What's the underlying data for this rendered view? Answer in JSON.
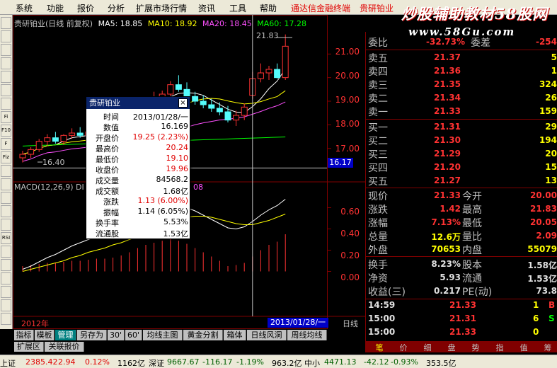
{
  "menu": {
    "items": [
      "系统",
      "功能",
      "报价",
      "分析",
      "扩展市场行情",
      "资讯",
      "工具",
      "帮助"
    ],
    "promo": "通达信金融终端",
    "current_stock": "贵研铂业",
    "watermark_line1": "炒股辅助教材58股网",
    "watermark_line2": "www.58Gu.com"
  },
  "toolbar_left": {
    "buttons": [
      "",
      "",
      "",
      "",
      "",
      "",
      "",
      "Fi",
      "F10",
      "F",
      "Fiz",
      "",
      "",
      "",
      "",
      "",
      "RSI",
      "",
      "",
      "",
      "",
      "",
      ""
    ]
  },
  "chart_header": {
    "stock": "贵研铂业(日线 前复权)",
    "ma5": "MA5: 18.85",
    "ma10": "MA10: 18.92",
    "ma20": "MA20: 18.45",
    "ma60": "MA60: 17.28"
  },
  "price_axis": [
    "21.00",
    "20.00",
    "19.00",
    "18.00",
    "17.00"
  ],
  "price_marker": "16.17",
  "high_annotation": "21.83",
  "low_annotation": "16.40",
  "macd_title": "MACD(12,26,9) DI",
  "macd_title_tail": "08",
  "macd_axis": [
    "0.60",
    "0.40",
    "0.20",
    "0.00"
  ],
  "date_left": "2012年",
  "date_cursor": "2013/01/28/一",
  "period": "日线",
  "chart_data": {
    "type": "candlestick",
    "series": [
      {
        "name": "MA5"
      },
      {
        "name": "MA10"
      },
      {
        "name": "MA20"
      },
      {
        "name": "MA60"
      }
    ],
    "candles": [
      {
        "o": 16.6,
        "h": 16.9,
        "l": 16.4,
        "c": 16.75
      },
      {
        "o": 16.75,
        "h": 17.05,
        "l": 16.6,
        "c": 16.95
      },
      {
        "o": 16.95,
        "h": 17.4,
        "l": 16.85,
        "c": 17.3
      },
      {
        "o": 17.3,
        "h": 17.6,
        "l": 17.1,
        "c": 17.45
      },
      {
        "o": 17.45,
        "h": 17.7,
        "l": 17.2,
        "c": 17.3
      },
      {
        "o": 17.3,
        "h": 17.6,
        "l": 17.15,
        "c": 17.55
      },
      {
        "o": 17.55,
        "h": 17.85,
        "l": 17.4,
        "c": 17.65
      },
      {
        "o": 17.65,
        "h": 17.9,
        "l": 17.45,
        "c": 17.55
      },
      {
        "o": 17.55,
        "h": 17.8,
        "l": 17.35,
        "c": 17.7
      },
      {
        "o": 17.7,
        "h": 18.0,
        "l": 17.55,
        "c": 17.85
      },
      {
        "o": 17.85,
        "h": 18.1,
        "l": 17.6,
        "c": 17.7
      },
      {
        "o": 17.7,
        "h": 17.95,
        "l": 17.5,
        "c": 17.8
      },
      {
        "o": 17.8,
        "h": 18.2,
        "l": 17.7,
        "c": 18.1
      },
      {
        "o": 18.1,
        "h": 18.6,
        "l": 17.95,
        "c": 18.45
      },
      {
        "o": 18.45,
        "h": 18.9,
        "l": 18.3,
        "c": 18.8
      },
      {
        "o": 18.8,
        "h": 19.2,
        "l": 18.6,
        "c": 19.05
      },
      {
        "o": 19.05,
        "h": 19.4,
        "l": 18.8,
        "c": 19.1
      },
      {
        "o": 19.1,
        "h": 19.45,
        "l": 18.85,
        "c": 19.3
      },
      {
        "o": 19.3,
        "h": 19.85,
        "l": 19.1,
        "c": 19.7
      },
      {
        "o": 19.7,
        "h": 20.1,
        "l": 19.4,
        "c": 19.5
      },
      {
        "o": 19.5,
        "h": 19.8,
        "l": 19.1,
        "c": 19.2
      },
      {
        "o": 19.2,
        "h": 19.4,
        "l": 18.85,
        "c": 19.0
      },
      {
        "o": 19.0,
        "h": 19.25,
        "l": 18.7,
        "c": 18.85
      },
      {
        "o": 18.85,
        "h": 19.1,
        "l": 18.55,
        "c": 18.7
      },
      {
        "o": 18.7,
        "h": 18.95,
        "l": 18.4,
        "c": 18.55
      },
      {
        "o": 18.55,
        "h": 18.8,
        "l": 18.1,
        "c": 18.2
      },
      {
        "o": 18.2,
        "h": 18.6,
        "l": 17.95,
        "c": 18.4
      },
      {
        "o": 18.4,
        "h": 18.9,
        "l": 18.2,
        "c": 18.75
      },
      {
        "o": 19.25,
        "h": 20.24,
        "l": 19.1,
        "c": 19.96
      },
      {
        "o": 19.96,
        "h": 20.6,
        "l": 19.8,
        "c": 20.2
      },
      {
        "o": 20.2,
        "h": 20.5,
        "l": 19.9,
        "c": 20.35
      },
      {
        "o": 20.35,
        "h": 20.6,
        "l": 19.95,
        "c": 20.0
      },
      {
        "o": 20.0,
        "h": 21.83,
        "l": 19.9,
        "c": 21.33
      }
    ],
    "macd": [
      0.05,
      0.06,
      0.07,
      0.08,
      0.08,
      0.09,
      0.1,
      0.1,
      0.11,
      0.12,
      0.12,
      0.13,
      0.15,
      0.18,
      0.22,
      0.25,
      0.27,
      0.29,
      0.31,
      0.29,
      0.26,
      0.22,
      0.18,
      0.14,
      0.1,
      0.05,
      0.06,
      0.08,
      0.14,
      0.2,
      0.25,
      0.28,
      0.35
    ],
    "diff": [
      0.02,
      0.05,
      0.09,
      0.13,
      0.16,
      0.2,
      0.24,
      0.27,
      0.3,
      0.33,
      0.35,
      0.37,
      0.4,
      0.44,
      0.5,
      0.55,
      0.58,
      0.6,
      0.62,
      0.62,
      0.6,
      0.57,
      0.53,
      0.49,
      0.45,
      0.41,
      0.4,
      0.42,
      0.47,
      0.53,
      0.58,
      0.62,
      0.68
    ],
    "dea": [
      0.0,
      0.02,
      0.04,
      0.06,
      0.08,
      0.1,
      0.13,
      0.15,
      0.18,
      0.2,
      0.22,
      0.25,
      0.27,
      0.3,
      0.33,
      0.36,
      0.4,
      0.43,
      0.46,
      0.49,
      0.51,
      0.52,
      0.52,
      0.51,
      0.49,
      0.47,
      0.45,
      0.44,
      0.44,
      0.46,
      0.48,
      0.51,
      0.54
    ],
    "cursor_index": 28,
    "ylim": [
      16.0,
      22.0
    ],
    "macd_ylim": [
      -0.05,
      0.75
    ]
  },
  "tooltip": {
    "title": "贵研铂业",
    "close": "×",
    "rows": [
      {
        "k": "时间",
        "v": "2013/01/28/一",
        "c": "black"
      },
      {
        "k": "数值",
        "v": "16.169",
        "c": "black"
      },
      {
        "k": "开盘价",
        "v": "19.25 (2.23%)",
        "c": "red"
      },
      {
        "k": "最高价",
        "v": "20.24",
        "c": "red"
      },
      {
        "k": "最低价",
        "v": "19.10",
        "c": "red"
      },
      {
        "k": "收盘价",
        "v": "19.96",
        "c": "red"
      },
      {
        "k": "成交量",
        "v": "84568.2",
        "c": "black"
      },
      {
        "k": "成交额",
        "v": "1.68亿",
        "c": "black"
      },
      {
        "k": "涨跌",
        "v": "1.13 (6.00%)",
        "c": "red"
      },
      {
        "k": "振幅",
        "v": "1.14 (6.05%)",
        "c": "black"
      },
      {
        "k": "换手率",
        "v": "5.53%",
        "c": "black"
      },
      {
        "k": "流通股",
        "v": "1.53亿",
        "c": "black"
      }
    ]
  },
  "orderbook": {
    "wb_label": "委比",
    "wb_value": "-32.73%",
    "wb_tail": "委差",
    "wb_num": "-254",
    "asks": [
      {
        "label": "卖五",
        "price": "21.37",
        "vol": "5"
      },
      {
        "label": "卖四",
        "price": "21.36",
        "vol": "1"
      },
      {
        "label": "卖三",
        "price": "21.35",
        "vol": "324"
      },
      {
        "label": "卖二",
        "price": "21.34",
        "vod": "",
        "vol": "26"
      },
      {
        "label": "卖一",
        "price": "21.33",
        "vol": "159"
      }
    ],
    "bids": [
      {
        "label": "买一",
        "price": "21.31",
        "vol": "29"
      },
      {
        "label": "买二",
        "price": "21.30",
        "vol": "194"
      },
      {
        "label": "买三",
        "price": "21.29",
        "vol": "20"
      },
      {
        "label": "买四",
        "price": "21.20",
        "vol": "15"
      },
      {
        "label": "买五",
        "price": "21.27",
        "vol": "13"
      }
    ]
  },
  "quote": [
    {
      "l1": "现价",
      "v1": "21.33",
      "l2": "今开",
      "v2": "20.00"
    },
    {
      "l1": "涨跌",
      "v1": "1.42",
      "l2": "最高",
      "v2": "21.83"
    },
    {
      "l1": "涨幅",
      "v1": "7.13%",
      "l2": "最低",
      "v2": "20.05"
    },
    {
      "l1": "总量",
      "v1": "12.6万",
      "l2": "量比",
      "v2": "2.09"
    },
    {
      "l1": "外盘",
      "v1": "70653",
      "l2": "内盘",
      "v2": "55079"
    }
  ],
  "fundamentals": [
    {
      "l1": "换手",
      "v1": "8.23%",
      "l2": "股本",
      "v2": "1.58亿"
    },
    {
      "l1": "净资",
      "v1": "5.93",
      "l2": "流通",
      "v2": "1.53亿"
    },
    {
      "l1": "收益(三)",
      "v1": "0.217",
      "l2": "PE(动)",
      "v2": "73.8"
    }
  ],
  "ticks": [
    {
      "time": "14:59",
      "price": "21.33",
      "vol": "1",
      "side": "B"
    },
    {
      "time": "15:00",
      "price": "21.31",
      "vol": "6",
      "side": "S"
    },
    {
      "time": "15:00",
      "price": "21.33",
      "vol": "0",
      "side": ""
    }
  ],
  "tabs_bottom": [
    "指标",
    "模板",
    "管理",
    "另存为",
    "30'",
    "60'",
    "均线主图",
    "黄金分割",
    "箱体",
    "日线风洞",
    "周线均线"
  ],
  "tabs_bottom2": [
    "扩展区",
    "关联报价"
  ],
  "tabs_right": [
    "笔",
    "价",
    "细",
    "盘",
    "势",
    "指",
    "值",
    "筹"
  ],
  "status": [
    {
      "t": "上证",
      "c": "blk"
    },
    {
      "t": "2385.42",
      "c": "red"
    },
    {
      "t": "2.94",
      "c": "red"
    },
    {
      "t": "0.12%",
      "c": "red"
    },
    {
      "t": "1162亿",
      "c": "blk"
    },
    {
      "t": "深证",
      "c": "blk"
    },
    {
      "t": "9667.67",
      "c": "grn"
    },
    {
      "t": "-116.17",
      "c": "grn"
    },
    {
      "t": "-1.19%",
      "c": "grn"
    },
    {
      "t": "963.2亿",
      "c": "blk"
    },
    {
      "t": "中小",
      "c": "blk"
    },
    {
      "t": "4471.13",
      "c": "grn"
    },
    {
      "t": "-42.12",
      "c": "grn"
    },
    {
      "t": "-0.93%",
      "c": "grn"
    },
    {
      "t": "353.5亿",
      "c": "blk"
    }
  ]
}
